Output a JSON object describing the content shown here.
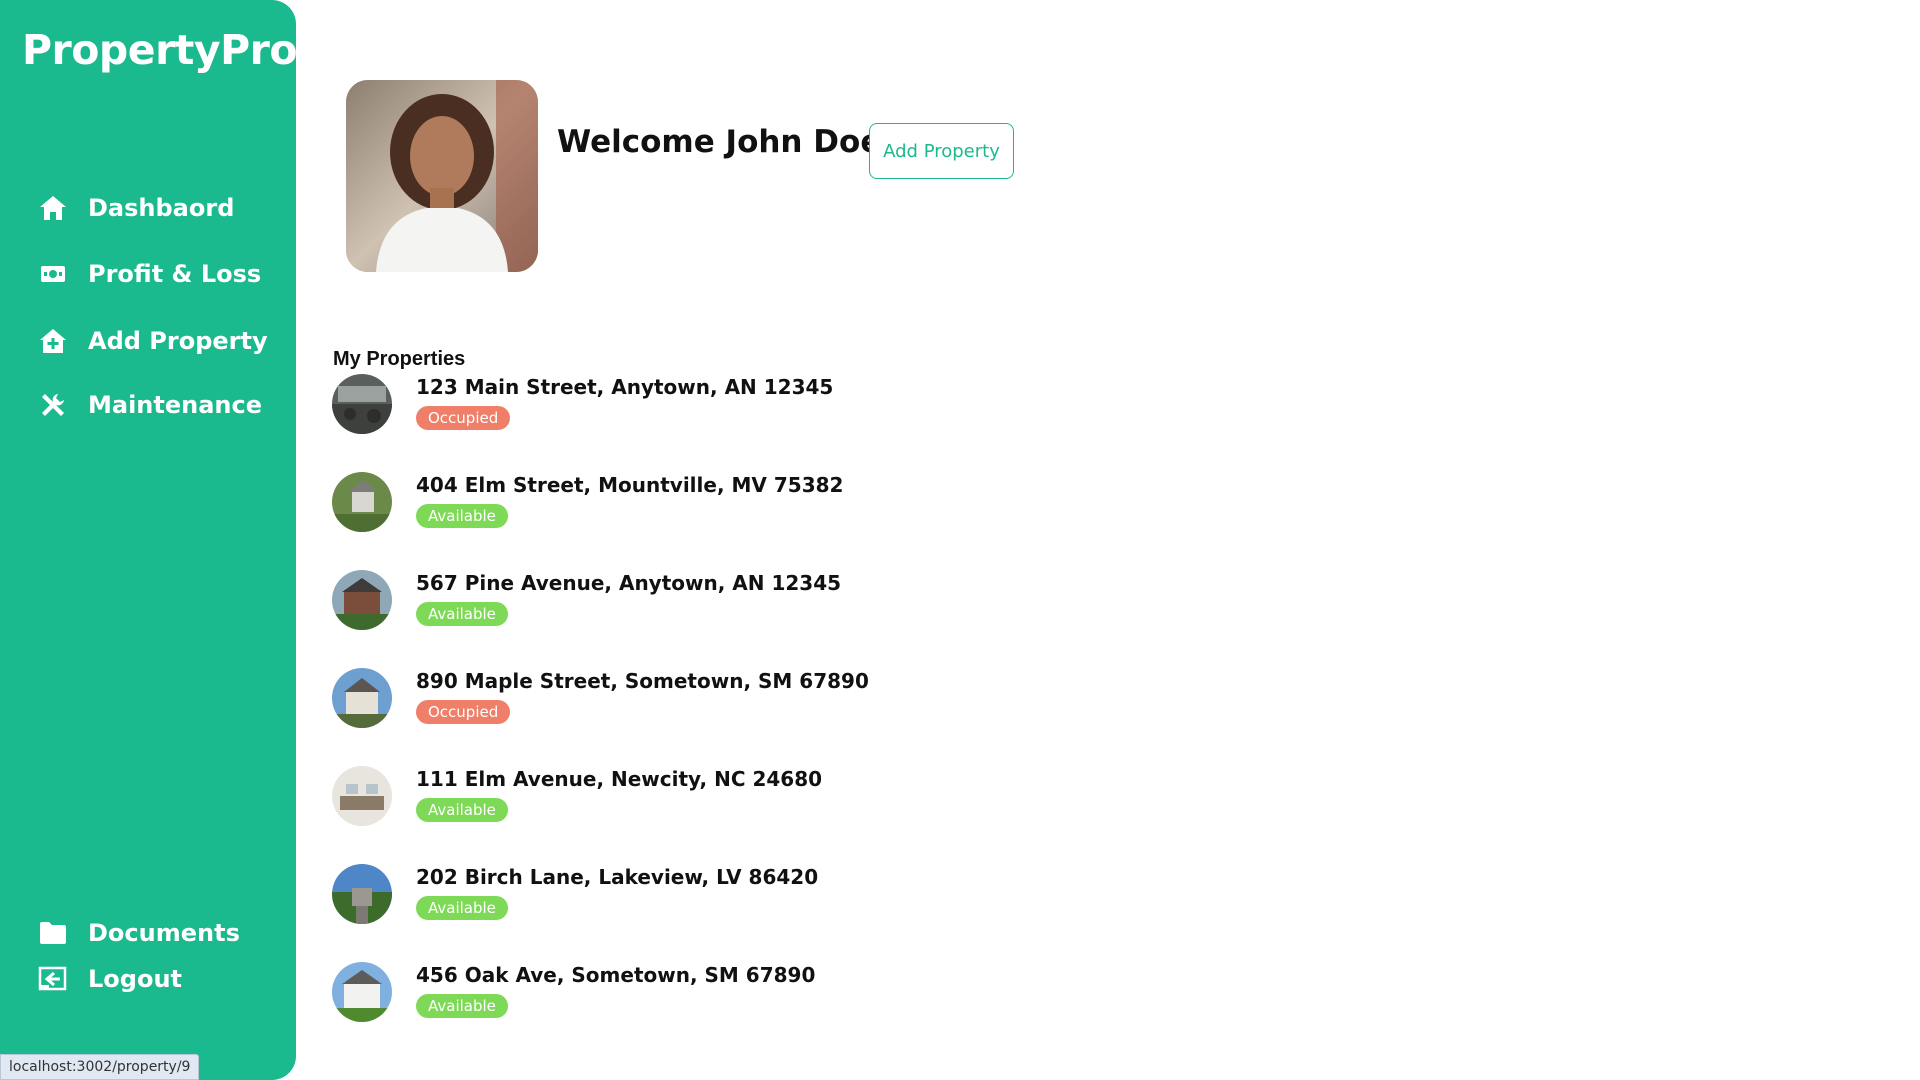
{
  "brand": "PropertyPro",
  "nav": {
    "dashboard": "Dashbaord",
    "profit_loss": "Profit & Loss",
    "add_property": "Add Property",
    "maintenance": "Maintenance",
    "documents": "Documents",
    "logout": "Logout"
  },
  "header": {
    "welcome": "Welcome John Doe",
    "add_property_button": "Add Property"
  },
  "properties_title": "My Properties",
  "properties": [
    {
      "address": "123 Main Street, Anytown, AN 12345",
      "status": "Occupied"
    },
    {
      "address": "404 Elm Street, Mountville, MV 75382",
      "status": "Available"
    },
    {
      "address": "567 Pine Avenue, Anytown, AN 12345",
      "status": "Available"
    },
    {
      "address": "890 Maple Street, Sometown, SM 67890",
      "status": "Occupied"
    },
    {
      "address": "111 Elm Avenue, Newcity, NC 24680",
      "status": "Available"
    },
    {
      "address": "202 Birch Lane, Lakeview, LV 86420",
      "status": "Available"
    },
    {
      "address": "456 Oak Ave, Sometown, SM 67890",
      "status": "Available"
    }
  ],
  "status_url": "localhost:3002/property/9",
  "colors": {
    "brand": "#1bb98e",
    "occupied": "#ef7f69",
    "available": "#7ed957"
  }
}
